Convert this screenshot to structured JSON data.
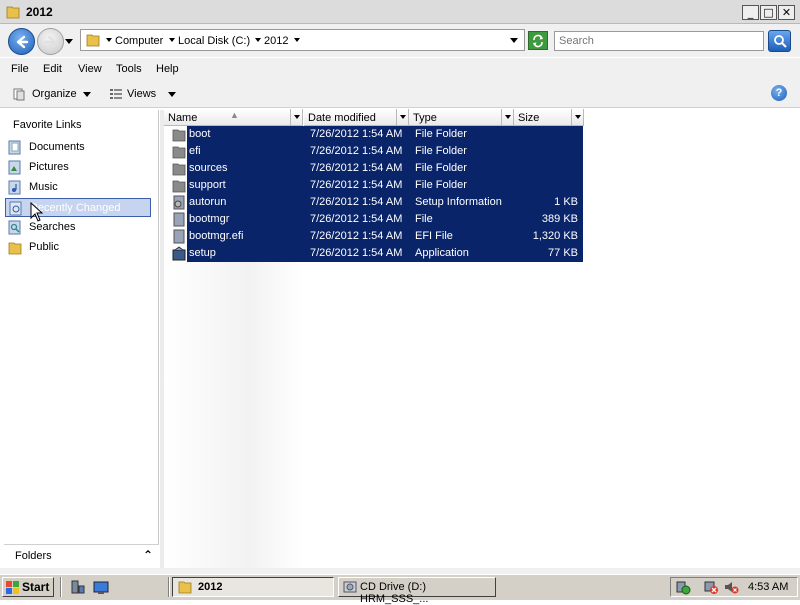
{
  "window": {
    "title": "2012",
    "minimize_glyph": "_",
    "maximize_glyph": "□",
    "close_glyph": "✕"
  },
  "address": {
    "crumbs": [
      "Computer",
      "Local Disk (C:)",
      "2012"
    ]
  },
  "search": {
    "placeholder": "Search"
  },
  "menu": {
    "items": [
      "File",
      "Edit",
      "View",
      "Tools",
      "Help"
    ]
  },
  "toolbar": {
    "organize_label": "Organize",
    "views_label": "Views",
    "help_glyph": "?"
  },
  "nav": {
    "header": "Favorite Links",
    "links": [
      {
        "label": "Documents",
        "icon": "documents-icon"
      },
      {
        "label": "Pictures",
        "icon": "pictures-icon"
      },
      {
        "label": "Music",
        "icon": "music-icon"
      },
      {
        "label": "Recently Changed",
        "icon": "recently-changed-icon"
      },
      {
        "label": "Searches",
        "icon": "searches-icon"
      },
      {
        "label": "Public",
        "icon": "public-folder-icon"
      }
    ],
    "folders_label": "Folders",
    "folders_glyph": "⌃"
  },
  "columns": [
    "Name",
    "Date modified",
    "Type",
    "Size"
  ],
  "files": [
    {
      "name": "boot",
      "date": "7/26/2012 1:54 AM",
      "type": "File Folder",
      "size": "",
      "icon": "folder-icon"
    },
    {
      "name": "efi",
      "date": "7/26/2012 1:54 AM",
      "type": "File Folder",
      "size": "",
      "icon": "folder-icon"
    },
    {
      "name": "sources",
      "date": "7/26/2012 1:54 AM",
      "type": "File Folder",
      "size": "",
      "icon": "folder-icon"
    },
    {
      "name": "support",
      "date": "7/26/2012 1:54 AM",
      "type": "File Folder",
      "size": "",
      "icon": "folder-icon"
    },
    {
      "name": "autorun",
      "date": "7/26/2012 1:54 AM",
      "type": "Setup Information",
      "size": "1 KB",
      "icon": "setup-info-icon"
    },
    {
      "name": "bootmgr",
      "date": "7/26/2012 1:54 AM",
      "type": "File",
      "size": "389 KB",
      "icon": "file-icon"
    },
    {
      "name": "bootmgr.efi",
      "date": "7/26/2012 1:54 AM",
      "type": "EFI File",
      "size": "1,320 KB",
      "icon": "file-icon"
    },
    {
      "name": "setup",
      "date": "7/26/2012 1:54 AM",
      "type": "Application",
      "size": "77 KB",
      "icon": "application-icon"
    }
  ],
  "taskbar": {
    "start_label": "Start",
    "tasks": [
      {
        "label": "2012",
        "active": true
      },
      {
        "label": "CD Drive (D:) HRM_SSS_..."
      }
    ],
    "clock": "4:53 AM"
  },
  "colors": {
    "selection": "#0a246a",
    "taskbar": "#d4d0c8",
    "chrome": "#f0f0f0"
  }
}
